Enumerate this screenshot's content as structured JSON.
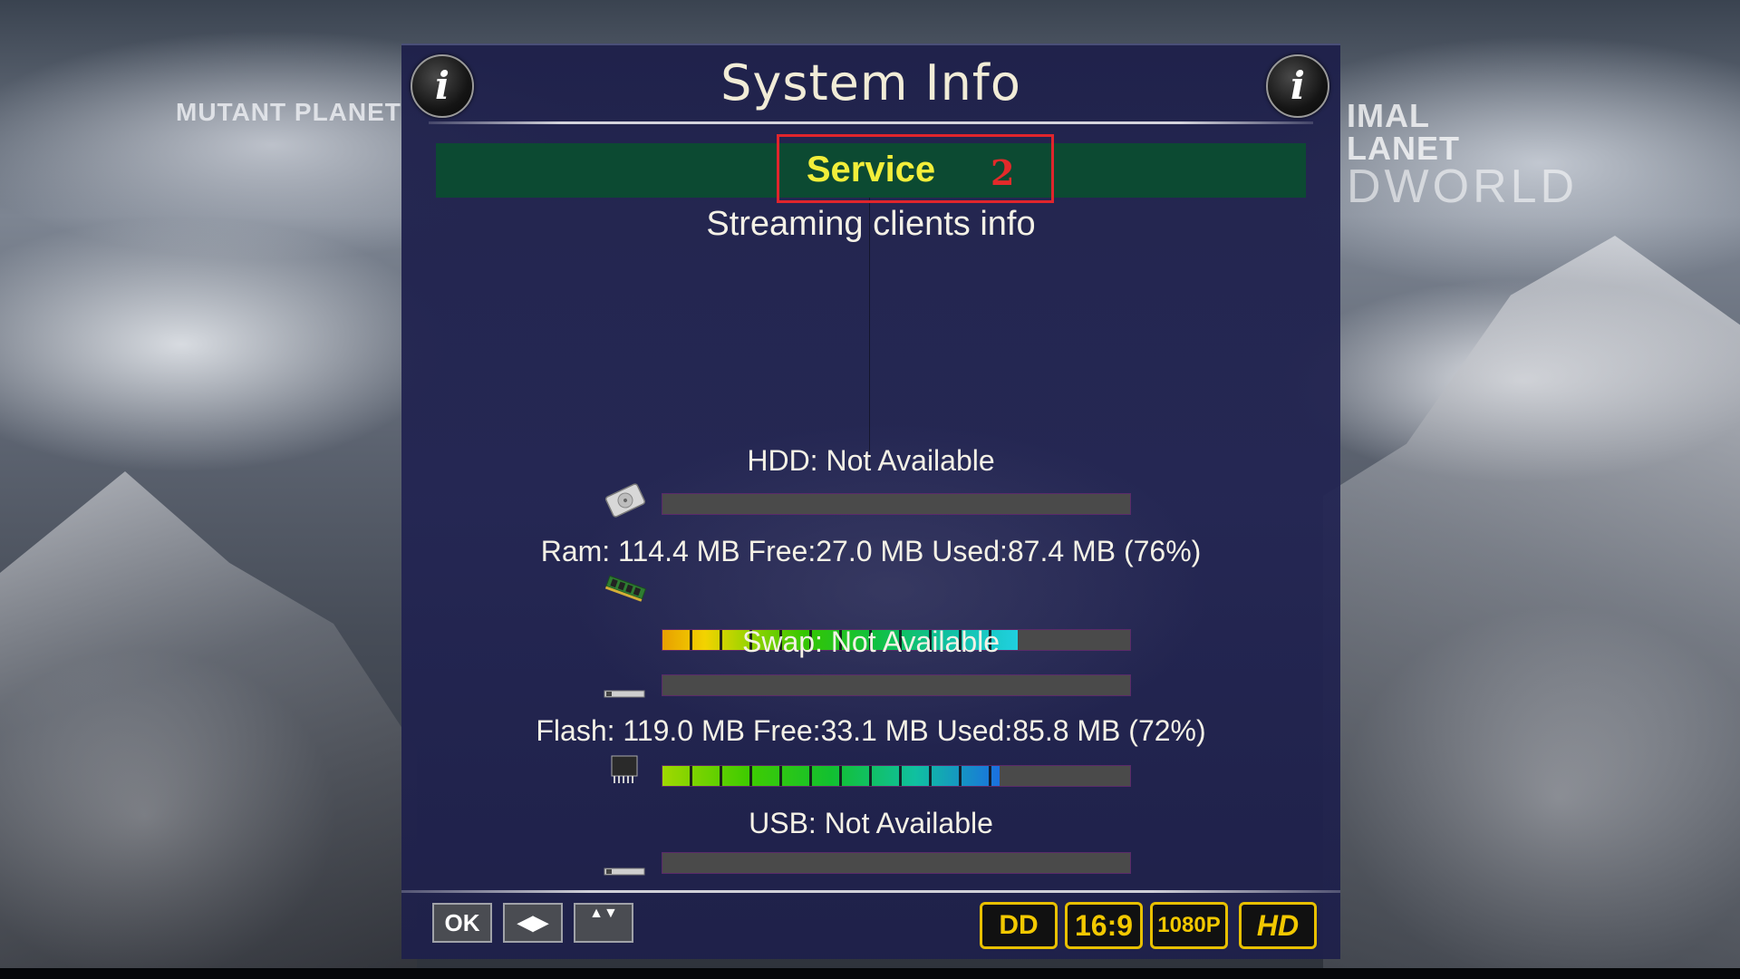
{
  "background": {
    "channel_logo_left": "MUTANT PLANET",
    "channel_logo_right_line1": "IMAL",
    "channel_logo_right_line2": "LANET",
    "channel_logo_right_line3": "DWORLD"
  },
  "header": {
    "title": "System Info",
    "info_icon_left": "i",
    "info_icon_right": "i"
  },
  "tab": {
    "label": "Service",
    "annotation_number": "2",
    "highlight_color": "#e0252c"
  },
  "subtitle": "Streaming clients info",
  "devices": [
    {
      "label": "HDD: Not Available",
      "icon": "hdd-icon",
      "usage_percent": 0
    },
    {
      "label": "Ram: 114.4 MB Free:27.0 MB Used:87.4 MB (76%)",
      "icon": "ram-icon",
      "usage_percent": 76
    },
    {
      "label": "Swap: Not Available",
      "icon": "swap-icon",
      "usage_percent": 0
    },
    {
      "label": "Flash: 119.0 MB Free:33.1 MB Used:85.8 MB (72%)",
      "icon": "flash-chip-icon",
      "usage_percent": 72
    },
    {
      "label": "USB: Not Available",
      "icon": "usb-icon",
      "usage_percent": 0
    }
  ],
  "footer": {
    "keys": {
      "ok": "OK",
      "left_right": "◀▶",
      "up_down": "▲▼"
    },
    "badges": {
      "audio": "DD",
      "aspect": "16:9",
      "resolution": "1080P",
      "hd": "HD"
    }
  },
  "colors": {
    "panel_bg": "#1e204a",
    "tab_bg": "#0c4a32",
    "tab_text": "#f2ee3a",
    "title_text": "#f1ecd7",
    "badge_border": "#e8c000"
  }
}
